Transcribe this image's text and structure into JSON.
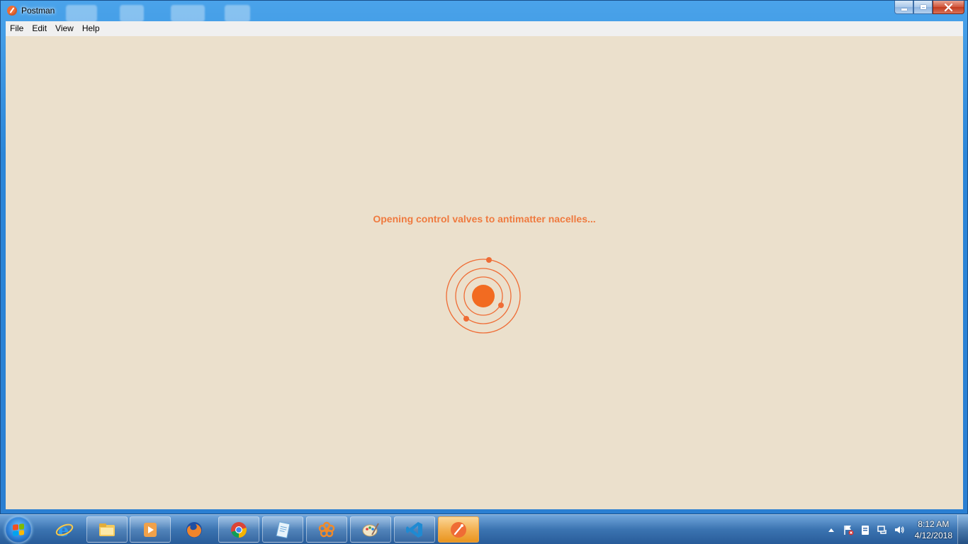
{
  "window": {
    "title": "Postman"
  },
  "menu": {
    "items": [
      "File",
      "Edit",
      "View",
      "Help"
    ]
  },
  "loading": {
    "message": "Opening control valves to antimatter nacelles..."
  },
  "colors": {
    "accent": "#ef6c35",
    "background": "#ebe0cc"
  },
  "taskbar": {
    "pinned": [
      {
        "name": "internet-explorer",
        "icon": "ie-icon"
      },
      {
        "name": "file-explorer",
        "icon": "folder-icon"
      },
      {
        "name": "media-player",
        "icon": "media-player-icon"
      },
      {
        "name": "firefox",
        "icon": "firefox-icon"
      },
      {
        "name": "chrome",
        "icon": "chrome-icon"
      },
      {
        "name": "notepad",
        "icon": "notepad-icon"
      },
      {
        "name": "app-flower",
        "icon": "flower-icon"
      },
      {
        "name": "paint",
        "icon": "paint-palette-icon"
      },
      {
        "name": "visual-studio-code",
        "icon": "vscode-icon"
      },
      {
        "name": "postman",
        "icon": "postman-icon",
        "active": true
      }
    ]
  },
  "clock": {
    "time": "8:12 AM",
    "date": "4/12/2018"
  }
}
